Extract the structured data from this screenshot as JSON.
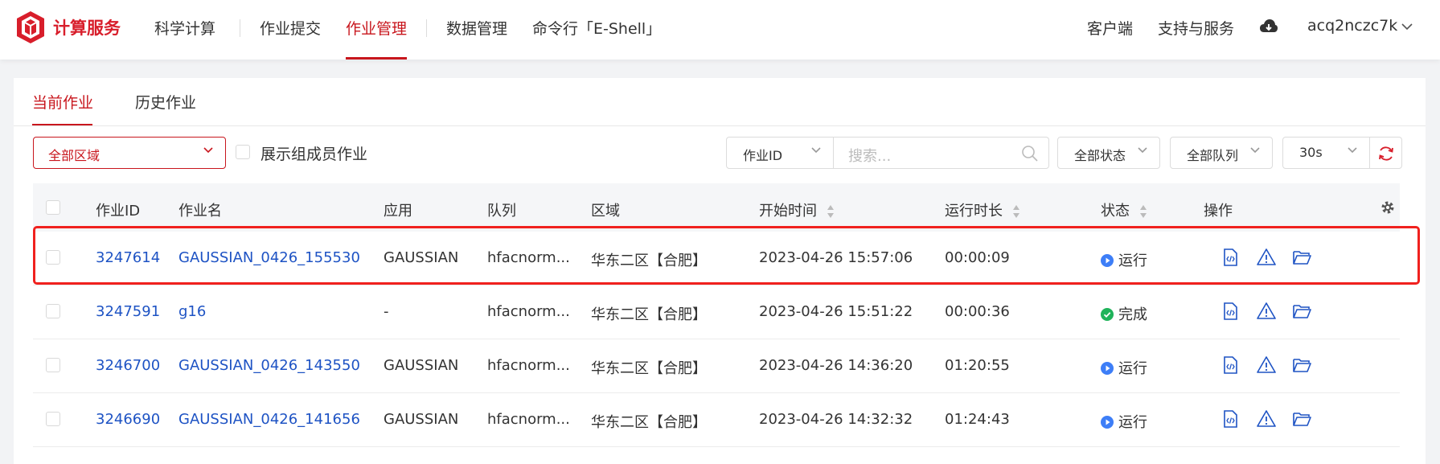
{
  "brand": {
    "name": "计算服务",
    "color": "#d81e2b"
  },
  "nav": {
    "items": [
      {
        "label": "科学计算"
      },
      {
        "label": "作业提交"
      },
      {
        "label": "作业管理",
        "active": true
      },
      {
        "label": "数据管理"
      },
      {
        "label": "命令行「E-Shell」"
      }
    ],
    "right": {
      "client": "客户端",
      "support": "支持与服务",
      "cloud_icon": "cloud-download-icon",
      "username": "acq2nczc7k"
    }
  },
  "tabs": [
    {
      "label": "当前作业",
      "active": true
    },
    {
      "label": "历史作业"
    }
  ],
  "filters": {
    "region": "全部区域",
    "show_members_label": "展示组成员作业",
    "search_field": "作业ID",
    "search_placeholder": "搜索...",
    "status": "全部状态",
    "queue": "全部队列",
    "refresh_interval": "30s"
  },
  "table": {
    "headers": {
      "id": "作业ID",
      "name": "作业名",
      "app": "应用",
      "queue": "队列",
      "region": "区域",
      "start": "开始时间",
      "duration": "运行时长",
      "status": "状态",
      "ops": "操作"
    },
    "rows": [
      {
        "id": "3247614",
        "name": "GAUSSIAN_0426_155530",
        "app": "GAUSSIAN",
        "queue": "hfacnorm...",
        "region": "华东二区【合肥】",
        "start": "2023-04-26 15:57:06",
        "duration": "00:00:09",
        "status": "运行",
        "status_type": "running",
        "highlighted": true
      },
      {
        "id": "3247591",
        "name": "g16",
        "app": "-",
        "queue": "hfacnorm...",
        "region": "华东二区【合肥】",
        "start": "2023-04-26 15:51:22",
        "duration": "00:00:36",
        "status": "完成",
        "status_type": "done"
      },
      {
        "id": "3246700",
        "name": "GAUSSIAN_0426_143550",
        "app": "GAUSSIAN",
        "queue": "hfacnorm...",
        "region": "华东二区【合肥】",
        "start": "2023-04-26 14:36:20",
        "duration": "01:20:55",
        "status": "运行",
        "status_type": "running"
      },
      {
        "id": "3246690",
        "name": "GAUSSIAN_0426_141656",
        "app": "GAUSSIAN",
        "queue": "hfacnorm...",
        "region": "华东二区【合肥】",
        "start": "2023-04-26 14:32:32",
        "duration": "01:24:43",
        "status": "运行",
        "status_type": "running"
      }
    ]
  },
  "colors": {
    "accent": "#c8161d",
    "link": "#1e53c4",
    "running": "#3d7ef7",
    "done": "#1fb35a",
    "highlight": "#f0211e"
  }
}
